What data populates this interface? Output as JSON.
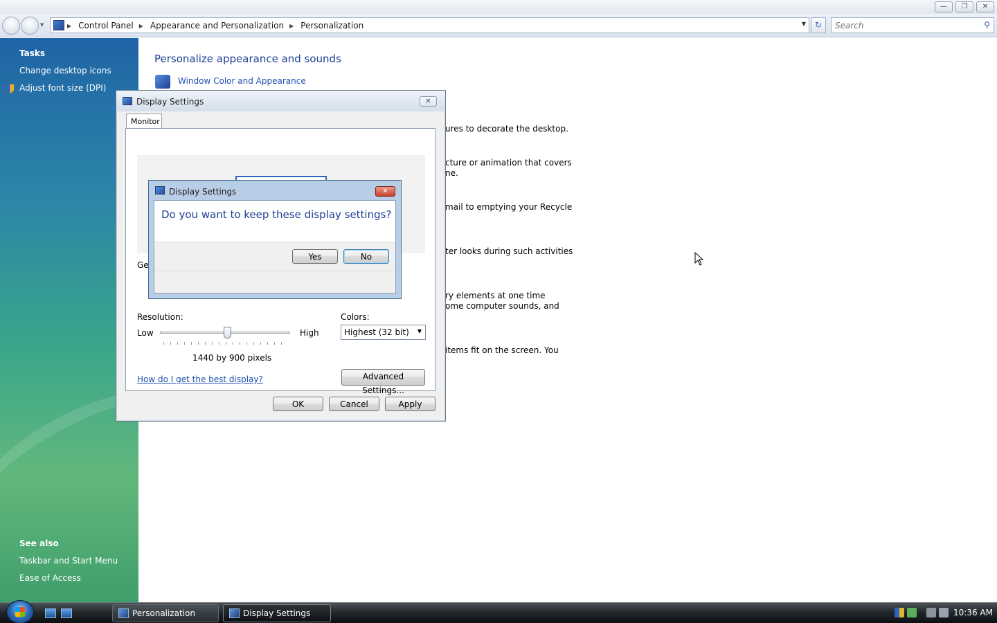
{
  "explorer": {
    "breadcrumb": [
      "Control Panel",
      "Appearance and Personalization",
      "Personalization"
    ],
    "search_placeholder": "Search"
  },
  "left_pane": {
    "tasks_heading": "Tasks",
    "tasks": [
      "Change desktop icons",
      "Adjust font size (DPI)"
    ],
    "see_also_heading": "See also",
    "see_also": [
      "Taskbar and Start Menu",
      "Ease of Access"
    ]
  },
  "main": {
    "title": "Personalize appearance and sounds",
    "first_link": "Window Color and Appearance",
    "fragments": [
      "ures to decorate the desktop.",
      "cture or animation that covers",
      "ne.",
      "mail to emptying your Recycle",
      "ter looks during such activities",
      "ry elements at one time",
      "ome computer sounds, and",
      "items fit on the screen. You"
    ]
  },
  "display_dialog": {
    "title": "Display Settings",
    "tab_label": "Monitor",
    "partial_label": "Ger",
    "resolution_label": "Resolution:",
    "low_label": "Low",
    "high_label": "High",
    "resolution_value": "1440 by 900 pixels",
    "slider_position": 0.52,
    "colors_label": "Colors:",
    "colors_value": "Highest (32 bit)",
    "help_link": "How do I get the best display?",
    "advanced_button": "Advanced Settings...",
    "ok_button": "OK",
    "cancel_button": "Cancel",
    "apply_button": "Apply"
  },
  "confirm_dialog": {
    "title": "Display Settings",
    "question": "Do you want to keep these display settings?",
    "yes_button": "Yes",
    "no_button": "No"
  },
  "taskbar": {
    "buttons": [
      "Personalization",
      "Display Settings"
    ],
    "clock": "10:36 AM"
  },
  "colors": {
    "link": "#1e4fb3",
    "heading": "#1b3f91"
  },
  "icons": [
    "back-icon",
    "forward-icon",
    "control-panel-icon",
    "refresh-icon",
    "search-icon",
    "shield-icon",
    "start-orb-icon"
  ]
}
